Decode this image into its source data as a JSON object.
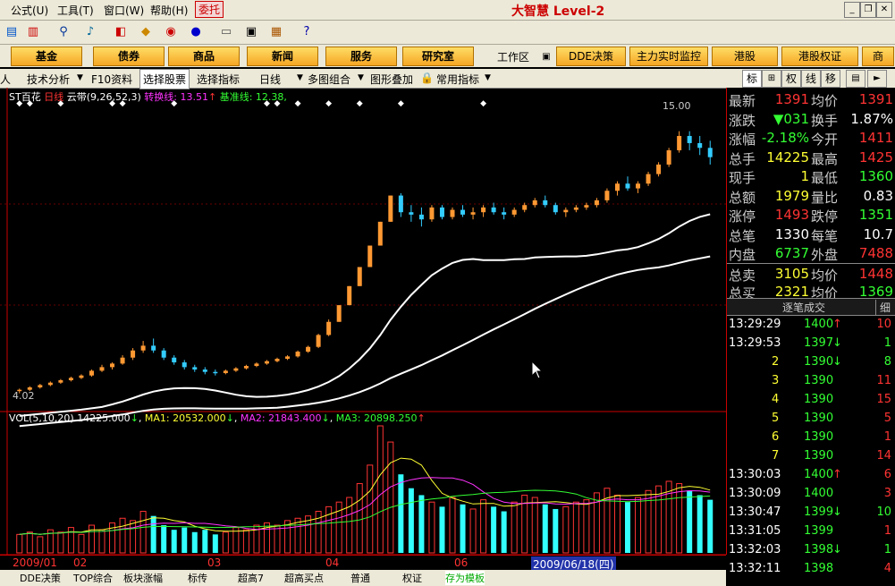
{
  "menu": {
    "items": [
      "公式(U)",
      "工具(T)",
      "窗口(W)",
      "帮助(H)"
    ],
    "weituo": "委托",
    "brand": "大智慧 Level-2"
  },
  "nav": {
    "buttons": [
      "基金",
      "债券",
      "商品",
      "新闻",
      "服务",
      "研究室"
    ],
    "workarea": "工作区",
    "right_buttons": [
      "DDE决策",
      "主力实时监控",
      "港股",
      "港股权证",
      "商"
    ]
  },
  "tabs": {
    "items": [
      "技术分析",
      "F10资料",
      "选择股票",
      "选择指标",
      "日线",
      "多图组合",
      "图形叠加",
      "常用指标"
    ],
    "active": "选择股票"
  },
  "right_tabs": [
    "标",
    "权",
    "线",
    "移"
  ],
  "legend": {
    "name": "ST百花",
    "period": "日线",
    "indicator": "云带(9,26,52,3)",
    "turn_label": "转换线: 13.51",
    "base_label": "基准线: 12.38,",
    "peak_label": "15.00",
    "low_label": "4.02"
  },
  "vol_legend": {
    "vol": "VOL(5,10,20)",
    "vol_val": "14225.000",
    "ma1": "MA1: 20532.000",
    "ma2": "MA2: 21843.400",
    "ma3": "MA3: 20898.250"
  },
  "quote": {
    "rows": [
      {
        "l1": "最新",
        "v1": "1391",
        "c1": "up",
        "l2": "均价",
        "v2": "1391",
        "c2": "up"
      },
      {
        "l1": "涨跌",
        "v1": "▼031",
        "c1": "dn",
        "l2": "换手",
        "v2": "1.87%",
        "c2": "wh"
      },
      {
        "l1": "涨幅",
        "v1": "-2.18%",
        "c1": "dn",
        "l2": "今开",
        "v2": "1411",
        "c2": "up"
      },
      {
        "l1": "总手",
        "v1": "14225",
        "c1": "ye",
        "l2": "最高",
        "v2": "1425",
        "c2": "up"
      },
      {
        "l1": "现手",
        "v1": "1",
        "c1": "ye",
        "l2": "最低",
        "v2": "1360",
        "c2": "dn"
      },
      {
        "l1": "总额",
        "v1": "1979",
        "c1": "ye",
        "l2": "量比",
        "v2": "0.83",
        "c2": "wh"
      },
      {
        "l1": "涨停",
        "v1": "1493",
        "c1": "up",
        "l2": "跌停",
        "v2": "1351",
        "c2": "dn"
      },
      {
        "l1": "总笔",
        "v1": "1330",
        "c1": "wh",
        "l2": "每笔",
        "v2": "10.7",
        "c2": "wh"
      },
      {
        "l1": "内盘",
        "v1": "6737",
        "c1": "dn",
        "l2": "外盘",
        "v2": "7488",
        "c2": "up"
      },
      {
        "l1": "总卖",
        "v1": "3105",
        "c1": "ye",
        "l2": "均价",
        "v2": "1448",
        "c2": "up"
      },
      {
        "l1": "总买",
        "v1": "2321",
        "c1": "ye",
        "l2": "均价",
        "v2": "1369",
        "c2": "dn"
      }
    ],
    "trade_title": "逐笔成交",
    "trade_tab": "细",
    "trades": [
      {
        "t": "13:29:29",
        "p": "1400",
        "a": "↑",
        "ac": "up",
        "v": "10"
      },
      {
        "t": "13:29:53",
        "p": "1397",
        "a": "↓",
        "ac": "dn",
        "v": "1"
      },
      {
        "t": "2",
        "p": "1390",
        "a": "↓",
        "ac": "dn",
        "v": "8"
      },
      {
        "t": "3",
        "p": "1390",
        "a": "",
        "ac": "",
        "v": "11"
      },
      {
        "t": "4",
        "p": "1390",
        "a": "",
        "ac": "",
        "v": "15"
      },
      {
        "t": "5",
        "p": "1390",
        "a": "",
        "ac": "",
        "v": "5"
      },
      {
        "t": "6",
        "p": "1390",
        "a": "",
        "ac": "",
        "v": "1"
      },
      {
        "t": "7",
        "p": "1390",
        "a": "",
        "ac": "",
        "v": "14"
      },
      {
        "t": "13:30:03",
        "p": "1400",
        "a": "↑",
        "ac": "up",
        "v": "6"
      },
      {
        "t": "13:30:09",
        "p": "1400",
        "a": "",
        "ac": "",
        "v": "3"
      },
      {
        "t": "13:30:47",
        "p": "1399",
        "a": "↓",
        "ac": "dn",
        "v": "10"
      },
      {
        "t": "13:31:05",
        "p": "1399",
        "a": "",
        "ac": "",
        "v": "1"
      },
      {
        "t": "13:32:03",
        "p": "1398",
        "a": "↓",
        "ac": "dn",
        "v": "1"
      },
      {
        "t": "13:32:11",
        "p": "1398",
        "a": "",
        "ac": "",
        "v": "4"
      }
    ]
  },
  "date_axis": [
    "2009/01",
    "02",
    "03",
    "04",
    "06"
  ],
  "cursor_date": "2009/06/18(四)",
  "bottom_tabs": [
    "DDE决策",
    "TOP综合",
    "板块涨幅",
    "标传",
    "超高7",
    "超高买点",
    "普通",
    "权证",
    "存为模板"
  ],
  "bottom_active": "存为模板",
  "colors": {
    "up": "#ff3333",
    "down": "#33ccff",
    "cloud": "#ffffff",
    "vol_up": "#ff3333",
    "vol_down": "#33ffff"
  },
  "chart_data": {
    "type": "candlestick",
    "title": "ST百花 日线",
    "ohlc": [
      [
        4.1,
        4.2,
        4.0,
        4.15
      ],
      [
        4.15,
        4.3,
        4.1,
        4.25
      ],
      [
        4.25,
        4.4,
        4.2,
        4.35
      ],
      [
        4.35,
        4.5,
        4.3,
        4.45
      ],
      [
        4.45,
        4.6,
        4.4,
        4.55
      ],
      [
        4.55,
        4.7,
        4.5,
        4.65
      ],
      [
        4.65,
        4.8,
        4.6,
        4.75
      ],
      [
        4.75,
        5.0,
        4.7,
        4.95
      ],
      [
        4.95,
        5.2,
        4.9,
        5.1
      ],
      [
        5.1,
        5.3,
        5.0,
        5.25
      ],
      [
        5.25,
        5.6,
        5.2,
        5.5
      ],
      [
        5.5,
        5.9,
        5.4,
        5.8
      ],
      [
        5.8,
        6.2,
        5.7,
        6.0
      ],
      [
        6.0,
        6.3,
        5.7,
        5.8
      ],
      [
        5.8,
        5.9,
        5.4,
        5.5
      ],
      [
        5.5,
        5.6,
        5.2,
        5.3
      ],
      [
        5.3,
        5.4,
        5.0,
        5.1
      ],
      [
        5.1,
        5.2,
        4.9,
        5.0
      ],
      [
        5.0,
        5.1,
        4.8,
        4.9
      ],
      [
        4.9,
        5.0,
        4.75,
        4.85
      ],
      [
        4.85,
        5.0,
        4.8,
        4.95
      ],
      [
        4.95,
        5.1,
        4.9,
        5.05
      ],
      [
        5.05,
        5.2,
        5.0,
        5.15
      ],
      [
        5.15,
        5.3,
        5.1,
        5.25
      ],
      [
        5.25,
        5.4,
        5.2,
        5.35
      ],
      [
        5.35,
        5.5,
        5.3,
        5.45
      ],
      [
        5.45,
        5.6,
        5.4,
        5.55
      ],
      [
        5.55,
        5.8,
        5.5,
        5.75
      ],
      [
        5.75,
        6.0,
        5.7,
        5.95
      ],
      [
        5.95,
        6.5,
        5.9,
        6.45
      ],
      [
        6.45,
        7.1,
        6.4,
        7.0
      ],
      [
        7.0,
        7.7,
        7.0,
        7.7
      ],
      [
        7.7,
        8.5,
        7.7,
        8.5
      ],
      [
        8.5,
        9.3,
        8.5,
        9.3
      ],
      [
        9.3,
        10.2,
        9.3,
        10.2
      ],
      [
        10.2,
        11.2,
        10.2,
        11.2
      ],
      [
        11.2,
        12.3,
        11.2,
        12.3
      ],
      [
        12.3,
        12.4,
        11.4,
        11.6
      ],
      [
        11.6,
        11.9,
        11.2,
        11.5
      ],
      [
        11.5,
        11.8,
        11.0,
        11.3
      ],
      [
        11.3,
        11.9,
        11.2,
        11.8
      ],
      [
        11.8,
        11.9,
        11.3,
        11.4
      ],
      [
        11.4,
        11.8,
        11.3,
        11.7
      ],
      [
        11.7,
        11.9,
        11.4,
        11.5
      ],
      [
        11.5,
        11.8,
        11.3,
        11.6
      ],
      [
        11.6,
        11.9,
        11.4,
        11.8
      ],
      [
        11.8,
        12.0,
        11.5,
        11.6
      ],
      [
        11.6,
        11.8,
        11.3,
        11.5
      ],
      [
        11.5,
        11.8,
        11.4,
        11.7
      ],
      [
        11.7,
        12.0,
        11.6,
        11.9
      ],
      [
        11.9,
        12.2,
        11.8,
        12.1
      ],
      [
        12.1,
        12.3,
        11.8,
        11.9
      ],
      [
        11.9,
        12.0,
        11.5,
        11.6
      ],
      [
        11.6,
        11.8,
        11.4,
        11.7
      ],
      [
        11.7,
        11.9,
        11.6,
        11.8
      ],
      [
        11.8,
        12.0,
        11.7,
        11.9
      ],
      [
        11.9,
        12.2,
        11.8,
        12.1
      ],
      [
        12.1,
        12.6,
        12.0,
        12.5
      ],
      [
        12.5,
        12.9,
        12.3,
        12.8
      ],
      [
        12.8,
        13.1,
        12.5,
        12.6
      ],
      [
        12.6,
        12.9,
        12.4,
        12.8
      ],
      [
        12.8,
        13.3,
        12.7,
        13.2
      ],
      [
        13.2,
        13.7,
        13.1,
        13.6
      ],
      [
        13.6,
        14.3,
        13.5,
        14.2
      ],
      [
        14.2,
        15.0,
        14.1,
        14.8
      ],
      [
        14.8,
        15.0,
        14.2,
        14.5
      ],
      [
        14.5,
        14.8,
        14.0,
        14.3
      ],
      [
        14.3,
        14.6,
        13.6,
        13.91
      ]
    ],
    "volume": [
      8,
      9,
      7,
      10,
      9,
      11,
      8,
      12,
      10,
      13,
      15,
      14,
      18,
      16,
      12,
      10,
      11,
      9,
      10,
      8,
      9,
      11,
      10,
      12,
      13,
      12,
      14,
      15,
      16,
      18,
      20,
      22,
      24,
      30,
      38,
      55,
      48,
      34,
      28,
      25,
      22,
      20,
      24,
      21,
      19,
      23,
      20,
      18,
      22,
      25,
      24,
      21,
      19,
      20,
      22,
      23,
      26,
      28,
      25,
      22,
      24,
      27,
      29,
      31,
      30,
      27,
      25,
      23
    ],
    "ylim": [
      3.5,
      16
    ],
    "xlabels": [
      "2009/01",
      "02",
      "03",
      "04",
      "06"
    ]
  }
}
